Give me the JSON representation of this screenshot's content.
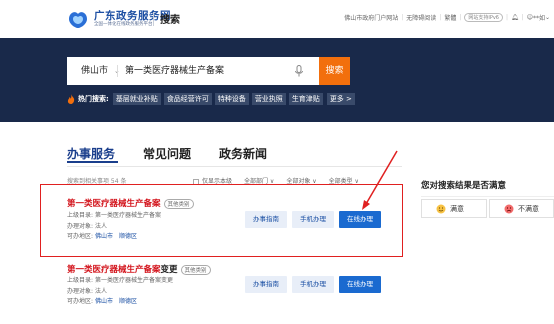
{
  "header": {
    "site_title": "广东政务服务网",
    "site_subtitle": "全国一体化在线政务服务平台",
    "search_label": "搜索",
    "top_links": [
      "佛山市政府门户网站",
      "无障碍阅读",
      "繁體"
    ],
    "ipv6_label": "网站支持IPv6",
    "user_label": "**如"
  },
  "search": {
    "city": "佛山市",
    "query": "第一类医疗器械生产备案",
    "button": "搜索"
  },
  "hot": {
    "label": "热门搜索:",
    "tags": [
      "基层就业补贴",
      "食品经营许可",
      "特种设备",
      "营业执照",
      "生育津贴"
    ],
    "more": "更多 >"
  },
  "tabs": [
    {
      "label": "办事服务",
      "active": true
    },
    {
      "label": "常见问题",
      "active": false
    },
    {
      "label": "政务新闻",
      "active": false
    }
  ],
  "filters": {
    "count_text": "搜索到相关事项 54 条",
    "options": [
      "仅显示本级",
      "全部部门 ∨",
      "全部对象 ∨",
      "全部类型 ∨"
    ]
  },
  "results": [
    {
      "title_red": "第一类医疗器械生产备案",
      "title_black": "",
      "badge": "其他类别",
      "dir_label": "上级目录:",
      "dir_value": "第一类医疗器械生产备案",
      "target_label": "办理对象:",
      "target_value": "法人",
      "area_label": "可办地区:",
      "areas": [
        "佛山市",
        "顺德区"
      ],
      "buttons": [
        "办事指南",
        "手机办理",
        "在线办理"
      ]
    },
    {
      "title_red": "第一类医疗器械生产备案",
      "title_black": "变更",
      "badge": "其他类别",
      "dir_label": "上级目录:",
      "dir_value": "第一类医疗器械生产备案变更",
      "target_label": "办理对象:",
      "target_value": "法人",
      "area_label": "可办地区:",
      "areas": [
        "佛山市",
        "顺德区"
      ],
      "buttons": [
        "办事指南",
        "手机办理",
        "在线办理"
      ]
    }
  ],
  "satisfaction": {
    "title": "您对搜索结果是否满意",
    "satisfied": "满意",
    "unsatisfied": "不满意"
  },
  "colors": {
    "accent_red": "#d3141c",
    "brand_blue": "#1a3e8c",
    "search_orange": "#f26f0d",
    "banner": "#19294a"
  }
}
